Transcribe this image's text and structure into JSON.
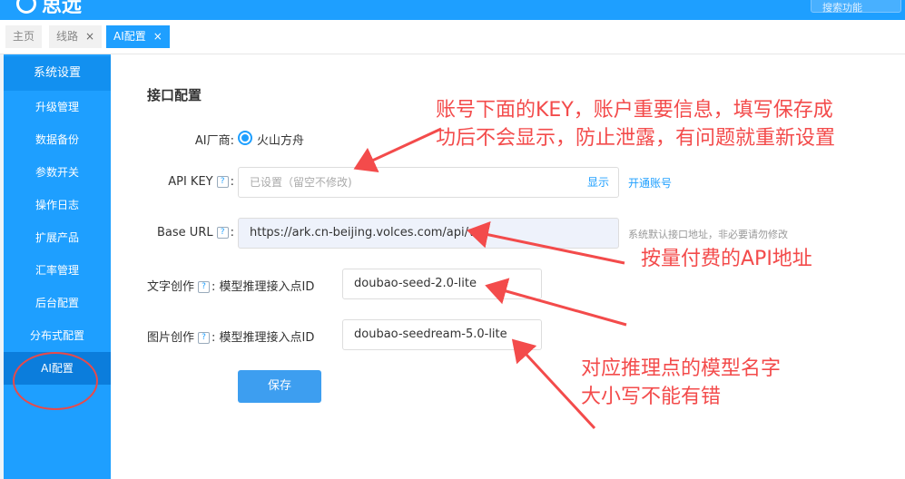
{
  "app": {
    "logo_text": "思远",
    "search_placeholder": "搜索功能"
  },
  "tabs": [
    {
      "label": "主页",
      "closable": false,
      "active": false
    },
    {
      "label": "线路",
      "closable": true,
      "active": false
    },
    {
      "label": "AI配置",
      "closable": true,
      "active": true
    }
  ],
  "tab_close_glyph": "×",
  "sidebar": {
    "header": "系统设置",
    "items": [
      {
        "label": "升级管理",
        "active": false
      },
      {
        "label": "数据备份",
        "active": false
      },
      {
        "label": "参数开关",
        "active": false
      },
      {
        "label": "操作日志",
        "active": false
      },
      {
        "label": "扩展产品",
        "active": false
      },
      {
        "label": "汇率管理",
        "active": false
      },
      {
        "label": "后台配置",
        "active": false
      },
      {
        "label": "分布式配置",
        "active": false
      },
      {
        "label": "AI配置",
        "active": true
      }
    ]
  },
  "form": {
    "section_title": "接口配置",
    "vendor_label": "AI厂商:",
    "vendor_value": "火山方舟",
    "api_key_label": "API KEY",
    "api_key_placeholder": "已设置（留空不修改)",
    "show_label": "显示",
    "open_account_label": "开通账号",
    "base_url_label": "Base URL",
    "base_url_value": "https://ark.cn-beijing.volces.com/api/v3",
    "base_url_hint": "系统默认接口地址，非必要请勿修改",
    "text_label": "文字创作",
    "text_sub_label": "模型推理接入点ID",
    "text_value": "doubao-seed-2.0-lite",
    "image_label": "图片创作",
    "image_sub_label": "模型推理接入点ID",
    "image_value": "doubao-seedream-5.0-lite",
    "help_glyph": "?",
    "colon": ":",
    "save_label": "保存"
  },
  "annotations": {
    "key_note_line1": "账号下面的KEY，账户重要信息，填写保存成",
    "key_note_line2": "功后不会显示，防止泄露，有问题就重新设置",
    "url_note": "按量付费的API地址",
    "model_note_line1": "对应推理点的模型名字",
    "model_note_line2": "大小写不能有错"
  },
  "colors": {
    "brand": "#1e9fff",
    "annotation": "#f34b4b"
  }
}
